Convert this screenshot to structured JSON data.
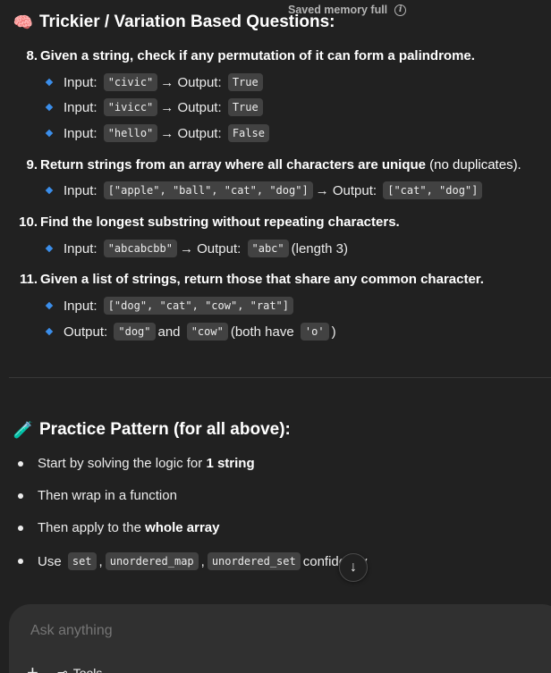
{
  "banner": {
    "text": "Saved memory full",
    "info_icon": "i"
  },
  "section1": {
    "emoji": "🧠",
    "title": "Trickier / Variation Based Questions:"
  },
  "items": [
    {
      "num": "8.",
      "title": "Given a string, check if any permutation of it can form a palindrome.",
      "subs": [
        {
          "label": "Input:",
          "input": "\"civic\"",
          "arrow": "→ Output:",
          "output": "True"
        },
        {
          "label": "Input:",
          "input": "\"ivicc\"",
          "arrow": "→ Output:",
          "output": "True"
        },
        {
          "label": "Input:",
          "input": "\"hello\"",
          "arrow": "→ Output:",
          "output": "False"
        }
      ]
    },
    {
      "num": "9.",
      "title": "Return strings from an array where all characters are unique",
      "title_note": "(no duplicates).",
      "subs": [
        {
          "label": "Input:",
          "input": "[\"apple\", \"ball\", \"cat\", \"dog\"]",
          "arrow": "→ Output:",
          "output": "[\"cat\", \"dog\"]"
        }
      ]
    },
    {
      "num": "10.",
      "title": "Find the longest substring without repeating characters.",
      "subs": [
        {
          "label": "Input:",
          "input": "\"abcabcbb\"",
          "arrow": "→ Output:",
          "output": "\"abc\"",
          "note": "(length 3)"
        }
      ]
    },
    {
      "num": "11.",
      "title": "Given a list of strings, return those that share any common character.",
      "subs": [
        {
          "label": "Input:",
          "input": "[\"dog\", \"cat\", \"cow\", \"rat\"]"
        },
        {
          "label": "Output:",
          "a": "\"dog\"",
          "and": "and",
          "b": "\"cow\"",
          "note_pre": "(both have",
          "char": "'o'",
          "note_post": ")"
        }
      ]
    }
  ],
  "section2": {
    "emoji": "🧪",
    "title": "Practice Pattern (for all above):"
  },
  "practice": [
    {
      "pre": "Start by solving the logic for",
      "bold": "1 string"
    },
    {
      "pre": "Then wrap in a function"
    },
    {
      "pre": "Then apply to the",
      "bold": "whole array"
    },
    {
      "pre": "Use",
      "c1": "set",
      "sep1": ",",
      "c2": "unordered_map",
      "sep2": ",",
      "c3": "unordered_set",
      "post": "confidently"
    }
  ],
  "scroll_icon": "↓",
  "composer": {
    "placeholder": "Ask anything",
    "plus": "+",
    "tools_icon": "⊸",
    "tools_label": "Tools"
  }
}
